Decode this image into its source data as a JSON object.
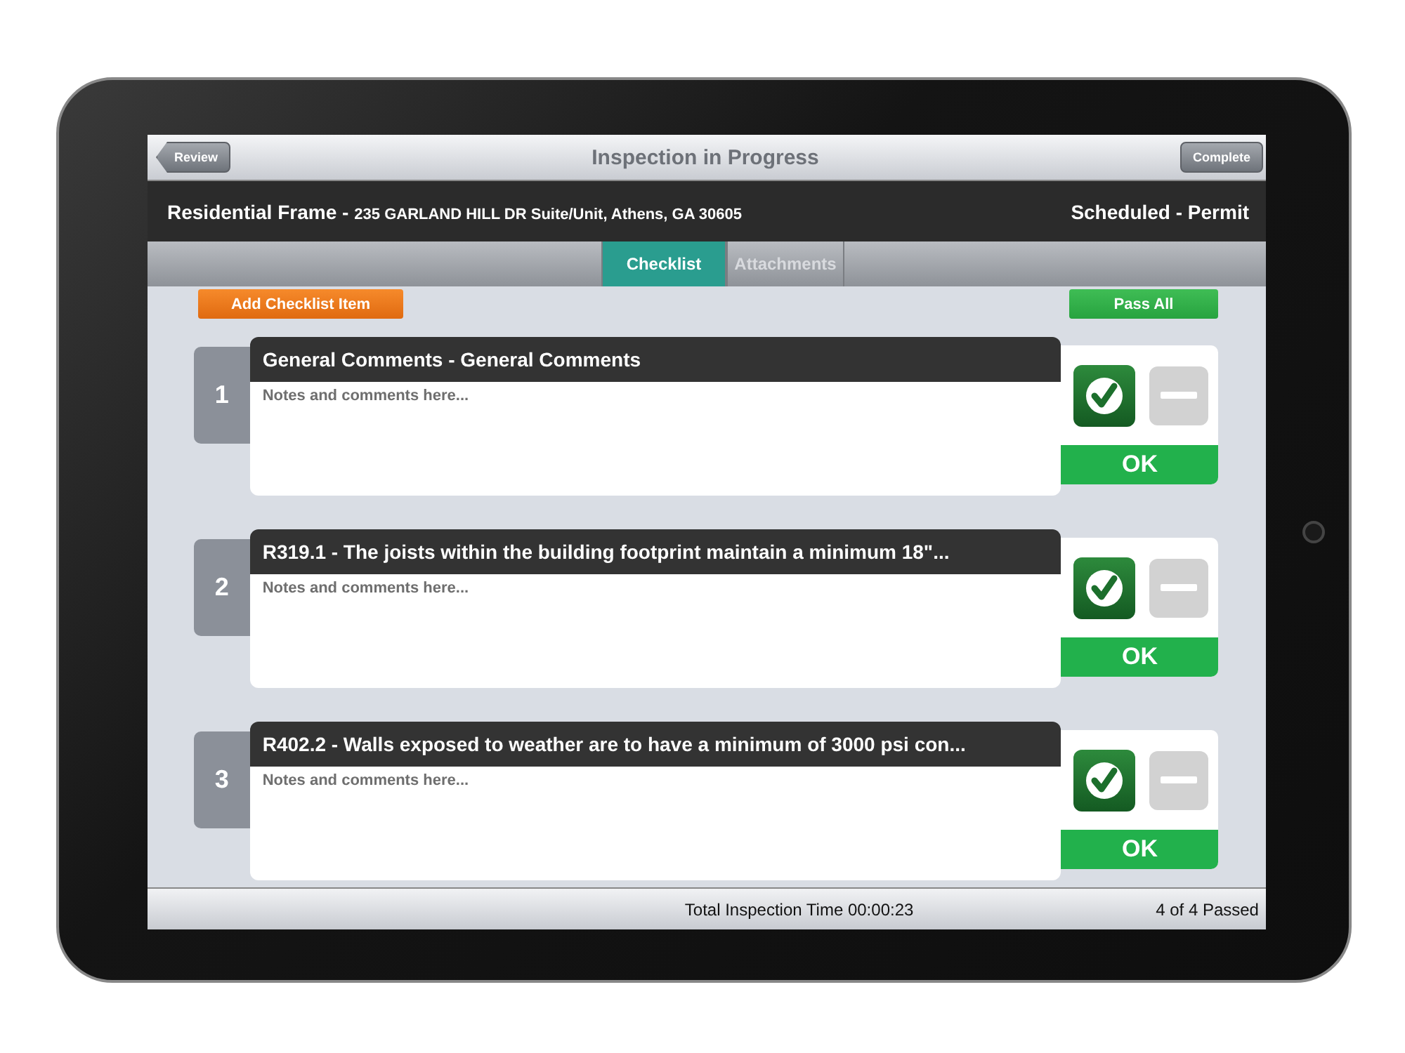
{
  "nav_bar": {
    "back_button": "Review",
    "title": "Inspection in Progress",
    "action_button": "Complete"
  },
  "info_bar": {
    "inspection_type": "Residential Frame -",
    "address": "235 GARLAND HILL DR Suite/Unit, Athens, GA 30605",
    "status": "Scheduled  - Permit"
  },
  "tabs": [
    {
      "label": "Checklist",
      "selected": true
    },
    {
      "label": "Attachments",
      "selected": false
    }
  ],
  "toolbar": {
    "add_button": "Add Checklist Item",
    "pass_all_button": "Pass All"
  },
  "checklist_items": [
    {
      "number": "1",
      "title": "General Comments - General Comments",
      "placeholder": "Notes and comments here...",
      "pass_checked": true,
      "na_checked": false,
      "result": "OK"
    },
    {
      "number": "2",
      "title": "R319.1 - The joists within the building footprint maintain a minimum 18\"...",
      "placeholder": "Notes and comments here...",
      "pass_checked": true,
      "na_checked": false,
      "result": "OK"
    },
    {
      "number": "3",
      "title": "R402.2 - Walls exposed to weather are to have a minimum of 3000 psi con...",
      "placeholder": "Notes and comments here...",
      "pass_checked": true,
      "na_checked": false,
      "result": "OK"
    }
  ],
  "footer": {
    "total_time": "Total Inspection Time 00:00:23",
    "passed_count": "4 of 4 Passed"
  }
}
